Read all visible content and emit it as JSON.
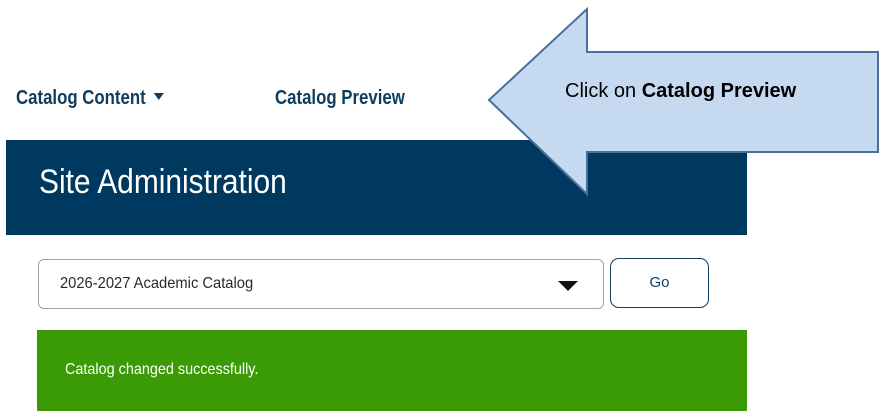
{
  "nav": {
    "catalog_content": "Catalog Content",
    "catalog_preview": "Catalog Preview"
  },
  "header": {
    "title": "Site Administration"
  },
  "catalog_select": {
    "selected": "2026-2027 Academic Catalog"
  },
  "go_button": {
    "label": "Go"
  },
  "status": {
    "message": "Catalog changed successfully."
  },
  "callout": {
    "prefix": "Click on ",
    "target": "Catalog Preview"
  },
  "colors": {
    "nav_text": "#0d3d5f",
    "header_bg": "#00395f",
    "success_bg": "#3a9b07",
    "callout_fill": "#c5d9f1",
    "callout_stroke": "#4a6f9a"
  },
  "icons": {
    "nav_dropdown": "caret-down-icon",
    "select_dropdown": "triangle-down-icon",
    "callout": "left-arrow-callout"
  }
}
